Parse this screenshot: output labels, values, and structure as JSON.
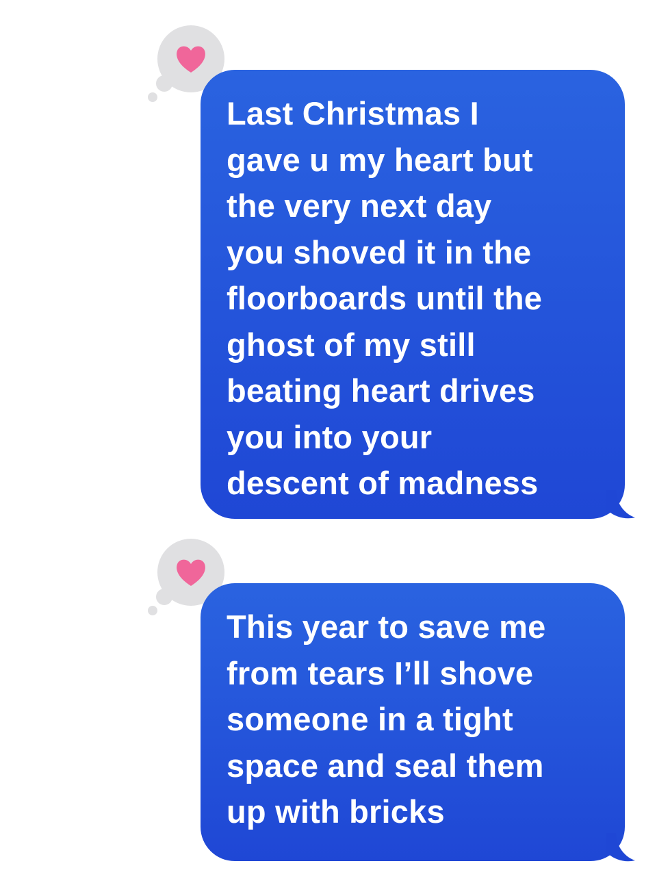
{
  "thread": {
    "messages": [
      {
        "direction": "outgoing",
        "text": "Last Christmas I\ngave u my heart but\nthe very next day\nyou shoved it in the\nfloorboards until the\nghost of my still\nbeating heart drives\nyou into your\ndescent of madness",
        "tapback": "heart-icon"
      },
      {
        "direction": "outgoing",
        "text": "This year to save me\nfrom tears I’ll shove\nsomeone in a tight\nspace and seal them\nup with bricks",
        "tapback": "heart-icon"
      }
    ]
  },
  "colors": {
    "bubble_top": "#2a63e0",
    "bubble_bottom": "#1f47d5",
    "tapback_bubble": "#e0e0e2",
    "heart": "#f0669a",
    "text": "#ffffff"
  }
}
